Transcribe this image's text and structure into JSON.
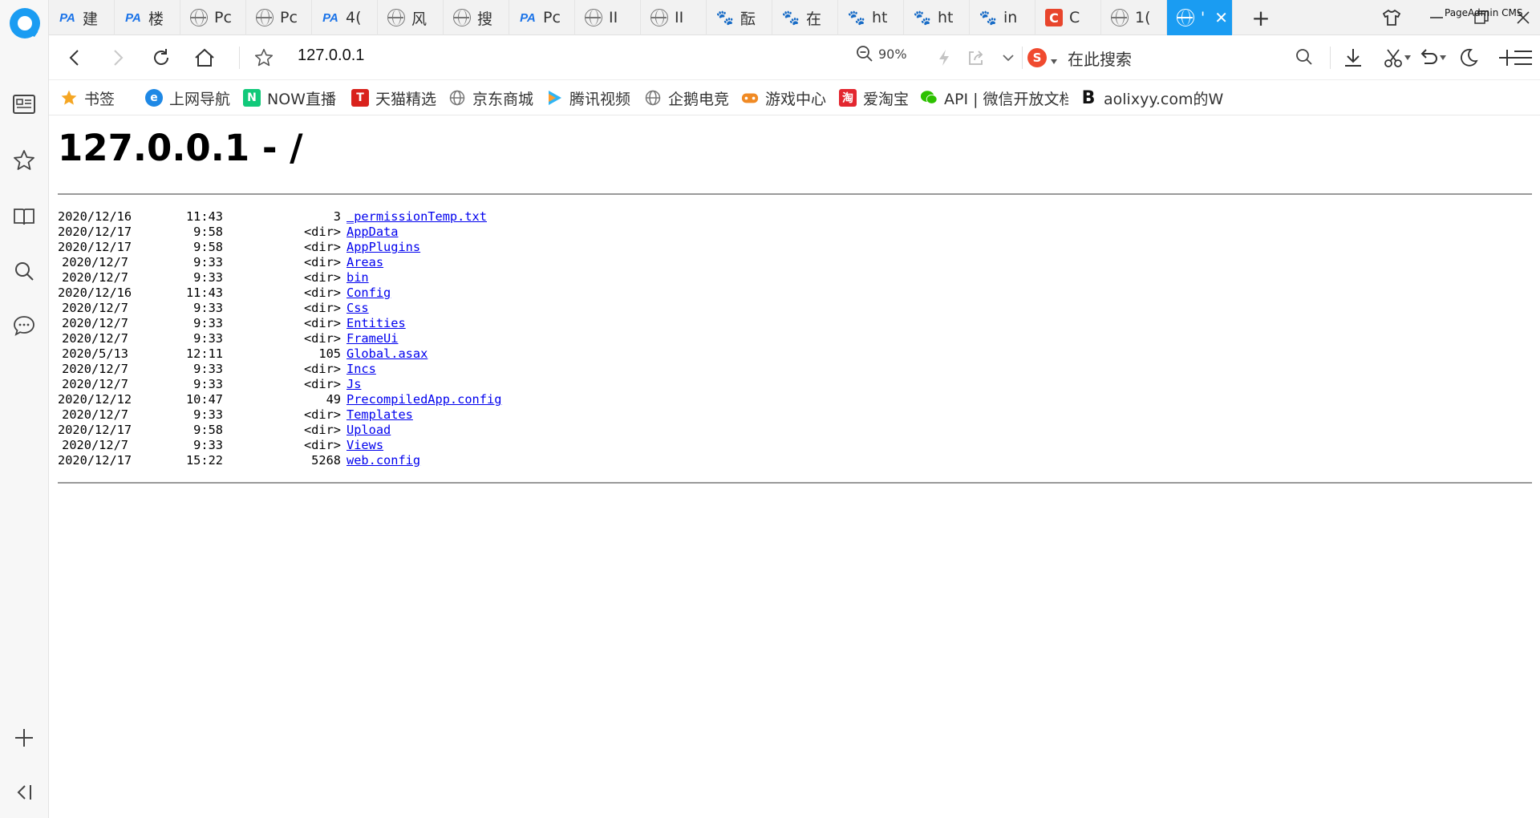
{
  "browser": {
    "tabs": [
      {
        "label": "建",
        "favicon": "pa"
      },
      {
        "label": "楼",
        "favicon": "pa"
      },
      {
        "label": "Pc",
        "favicon": "globe"
      },
      {
        "label": "Pc",
        "favicon": "globe"
      },
      {
        "label": "4(",
        "favicon": "pa"
      },
      {
        "label": "风",
        "favicon": "globe"
      },
      {
        "label": "搜",
        "favicon": "globe"
      },
      {
        "label": "Pc",
        "favicon": "pa"
      },
      {
        "label": "II",
        "favicon": "globe"
      },
      {
        "label": "II",
        "favicon": "globe"
      },
      {
        "label": "酝",
        "favicon": "paw"
      },
      {
        "label": "在",
        "favicon": "paw"
      },
      {
        "label": "ht",
        "favicon": "paw"
      },
      {
        "label": "ht",
        "favicon": "paw"
      },
      {
        "label": "in",
        "favicon": "paw"
      },
      {
        "label": "C",
        "favicon": "c"
      },
      {
        "label": "1(",
        "favicon": "globe"
      },
      {
        "label": "'",
        "favicon": "globe",
        "active": true
      }
    ],
    "window_title": "PageAdmin CMS",
    "address": "127.0.0.1",
    "zoom": "90%",
    "search_placeholder": "在此搜索",
    "sogou_glyph": "S",
    "accent_color": "#1a9cf2"
  },
  "bookmarks": [
    {
      "label": "书签",
      "icon": "star-icon"
    },
    {
      "label": "上网导航",
      "icon": "ie-icon",
      "glyph": "e"
    },
    {
      "label": "NOW直播",
      "icon": "now-icon",
      "glyph": "N"
    },
    {
      "label": "天猫精选",
      "icon": "tmall-icon",
      "glyph": "T"
    },
    {
      "label": "京东商城",
      "icon": "globe-icon"
    },
    {
      "label": "腾讯视频",
      "icon": "video-play-icon"
    },
    {
      "label": "企鹅电竞",
      "icon": "globe-icon"
    },
    {
      "label": "游戏中心",
      "icon": "gamepad-icon"
    },
    {
      "label": "爱淘宝",
      "icon": "taobao-icon",
      "glyph": "淘"
    },
    {
      "label": "API | 微信开放文档",
      "icon": "wechat-icon"
    },
    {
      "label": "aolixyy.com的WI",
      "icon": "b-icon",
      "glyph": "B"
    }
  ],
  "page": {
    "heading": "127.0.0.1 - /",
    "listing": [
      {
        "date": "2020/12/16",
        "time": "11:43",
        "size": "3",
        "name": "_permissionTemp.txt"
      },
      {
        "date": "2020/12/17",
        "time": "9:58",
        "size": "<dir>",
        "name": "AppData"
      },
      {
        "date": "2020/12/17",
        "time": "9:58",
        "size": "<dir>",
        "name": "AppPlugins"
      },
      {
        "date": "2020/12/7",
        "time": "9:33",
        "size": "<dir>",
        "name": "Areas"
      },
      {
        "date": "2020/12/7",
        "time": "9:33",
        "size": "<dir>",
        "name": "bin"
      },
      {
        "date": "2020/12/16",
        "time": "11:43",
        "size": "<dir>",
        "name": "Config"
      },
      {
        "date": "2020/12/7",
        "time": "9:33",
        "size": "<dir>",
        "name": "Css"
      },
      {
        "date": "2020/12/7",
        "time": "9:33",
        "size": "<dir>",
        "name": "Entities"
      },
      {
        "date": "2020/12/7",
        "time": "9:33",
        "size": "<dir>",
        "name": "FrameUi"
      },
      {
        "date": "2020/5/13",
        "time": "12:11",
        "size": "105",
        "name": "Global.asax"
      },
      {
        "date": "2020/12/7",
        "time": "9:33",
        "size": "<dir>",
        "name": "Incs"
      },
      {
        "date": "2020/12/7",
        "time": "9:33",
        "size": "<dir>",
        "name": "Js"
      },
      {
        "date": "2020/12/12",
        "time": "10:47",
        "size": "49",
        "name": "PrecompiledApp.config"
      },
      {
        "date": "2020/12/7",
        "time": "9:33",
        "size": "<dir>",
        "name": "Templates"
      },
      {
        "date": "2020/12/17",
        "time": "9:58",
        "size": "<dir>",
        "name": "Upload"
      },
      {
        "date": "2020/12/7",
        "time": "9:33",
        "size": "<dir>",
        "name": "Views"
      },
      {
        "date": "2020/12/17",
        "time": "15:22",
        "size": "5268",
        "name": "web.config"
      }
    ]
  }
}
